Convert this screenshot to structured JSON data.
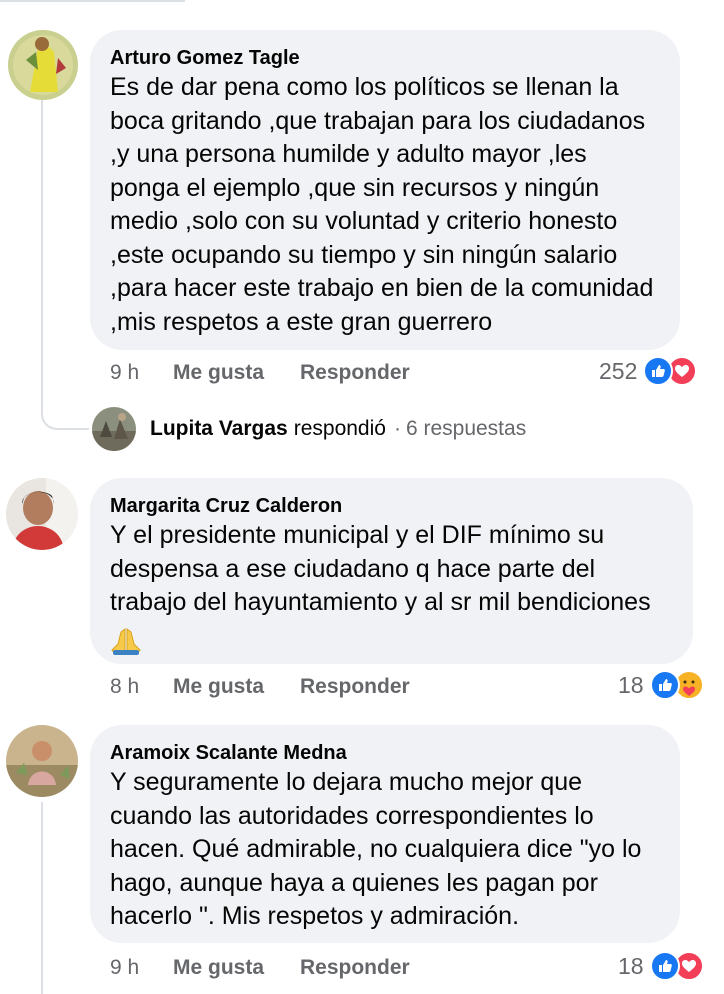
{
  "comments": [
    {
      "author": "Arturo Gomez Tagle",
      "text": "Es de dar pena como los políticos se llenan la boca gritando ,que trabajan para los ciudadanos ,y una persona humilde y adulto mayor ,les ponga el ejemplo ,que sin recursos y ningún medio ,solo con su voluntad y criterio honesto ,este ocupando su tiempo y sin ningún salario ,para hacer este trabajo en bien de la comunidad ,mis respetos a este gran guerrero",
      "time": "9 h",
      "like_label": "Me gusta",
      "reply_label": "Responder",
      "reaction_count": "252",
      "reactions": [
        "like-icon",
        "love-icon"
      ]
    },
    {
      "author": "Margarita Cruz Calderon",
      "text": "Y el presidente municipal y el DIF mínimo su despensa a ese ciudadano q hace parte del trabajo del hayuntamiento y al sr mil bendiciones",
      "emoji": "🙏",
      "time": "8 h",
      "like_label": "Me gusta",
      "reply_label": "Responder",
      "reaction_count": "18",
      "reactions": [
        "like-icon",
        "care-icon"
      ]
    },
    {
      "author": "Aramoix Scalante Medna",
      "text": "Y seguramente lo dejara mucho mejor que cuando las autoridades correspondientes lo hacen. Qué admirable, no cualquiera dice \"yo lo hago, aunque haya a quienes les pagan por hacerlo \". Mis respetos y admiración.",
      "time": "9 h",
      "like_label": "Me gusta",
      "reply_label": "Responder",
      "reaction_count": "18",
      "reactions": [
        "like-icon",
        "love-icon"
      ]
    }
  ],
  "reply_summary": {
    "name": "Lupita Vargas",
    "verb": "respondió",
    "separator": "·",
    "count": "6 respuestas"
  },
  "colors": {
    "bubble": "#f0f2f5",
    "meta_text": "#65676b",
    "like_blue": "#1877f2",
    "love_red": "#f33e58",
    "care_yellow": "#f7b125"
  }
}
